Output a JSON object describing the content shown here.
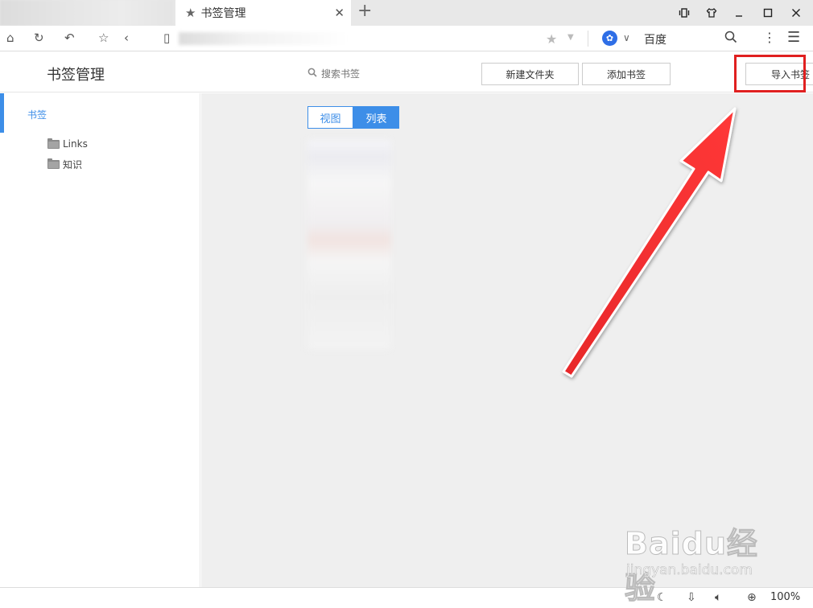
{
  "browser": {
    "active_tab_title": "书签管理",
    "active_tab_icon": "star-icon",
    "search_engine_name": "百度",
    "zoom_level": "100%"
  },
  "header": {
    "title": "书签管理",
    "search_placeholder": "搜索书签",
    "new_folder_label": "新建文件夹",
    "add_bookmark_label": "添加书签",
    "import_label": "导入书签"
  },
  "sidebar": {
    "root_label": "书签",
    "folders": [
      {
        "label": "Links"
      },
      {
        "label": "知识"
      }
    ]
  },
  "main": {
    "view_grid_label": "视图",
    "view_list_label": "列表",
    "active_view": "列表"
  },
  "watermark": {
    "brand": "Baidu经验",
    "url": "jingyan.baidu.com"
  },
  "colors": {
    "accent": "#3d8ee8",
    "highlight": "#e02020",
    "content_bg": "#efefef"
  }
}
